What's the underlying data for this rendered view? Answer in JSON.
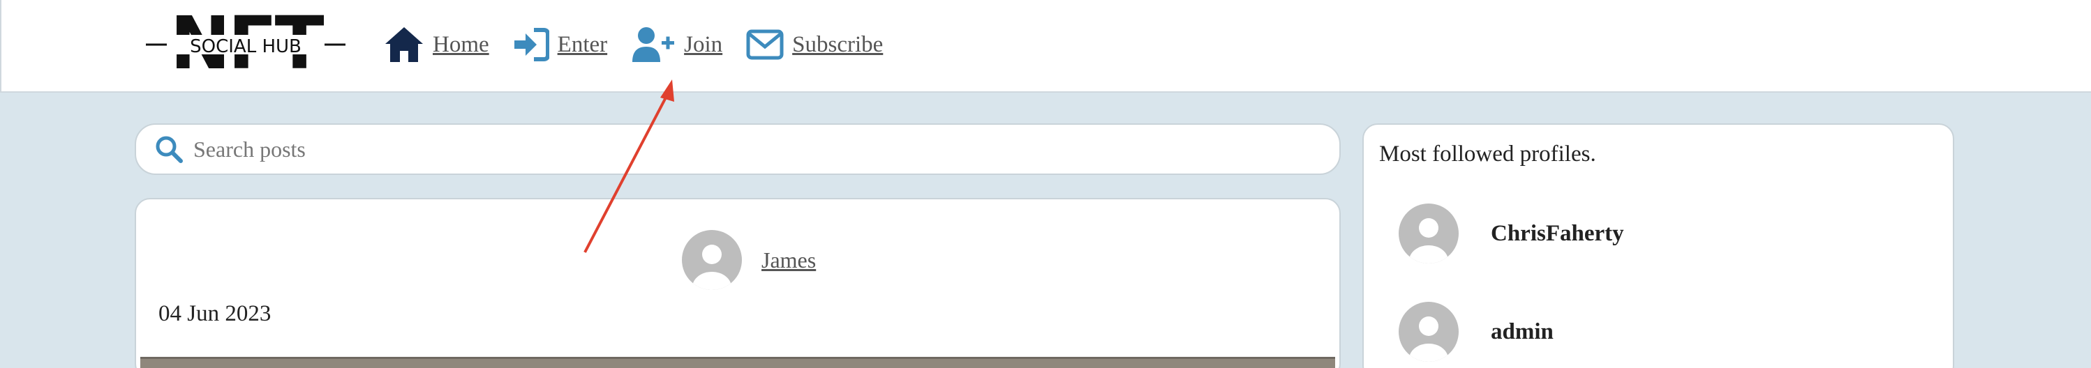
{
  "header": {
    "logo": {
      "top_text": "NFT",
      "bottom_text": "SOCIAL HUB"
    },
    "nav": [
      {
        "label": "Home",
        "icon": "home-icon"
      },
      {
        "label": "Enter",
        "icon": "sign-in-icon"
      },
      {
        "label": "Join",
        "icon": "user-plus-icon"
      },
      {
        "label": "Subscribe",
        "icon": "envelope-icon"
      }
    ]
  },
  "search": {
    "placeholder": "Search posts",
    "icon": "search-icon"
  },
  "post": {
    "author": "James",
    "date": "04 Jun 2023"
  },
  "sidebar": {
    "title": "Most followed profiles.",
    "profiles": [
      {
        "name": "ChrisFaherty"
      },
      {
        "name": "admin"
      }
    ]
  },
  "colors": {
    "page_bg": "#d9e5ec",
    "icon_blue": "#3d8bbd",
    "home_navy": "#14284b",
    "annotation_red": "#e0402e"
  }
}
